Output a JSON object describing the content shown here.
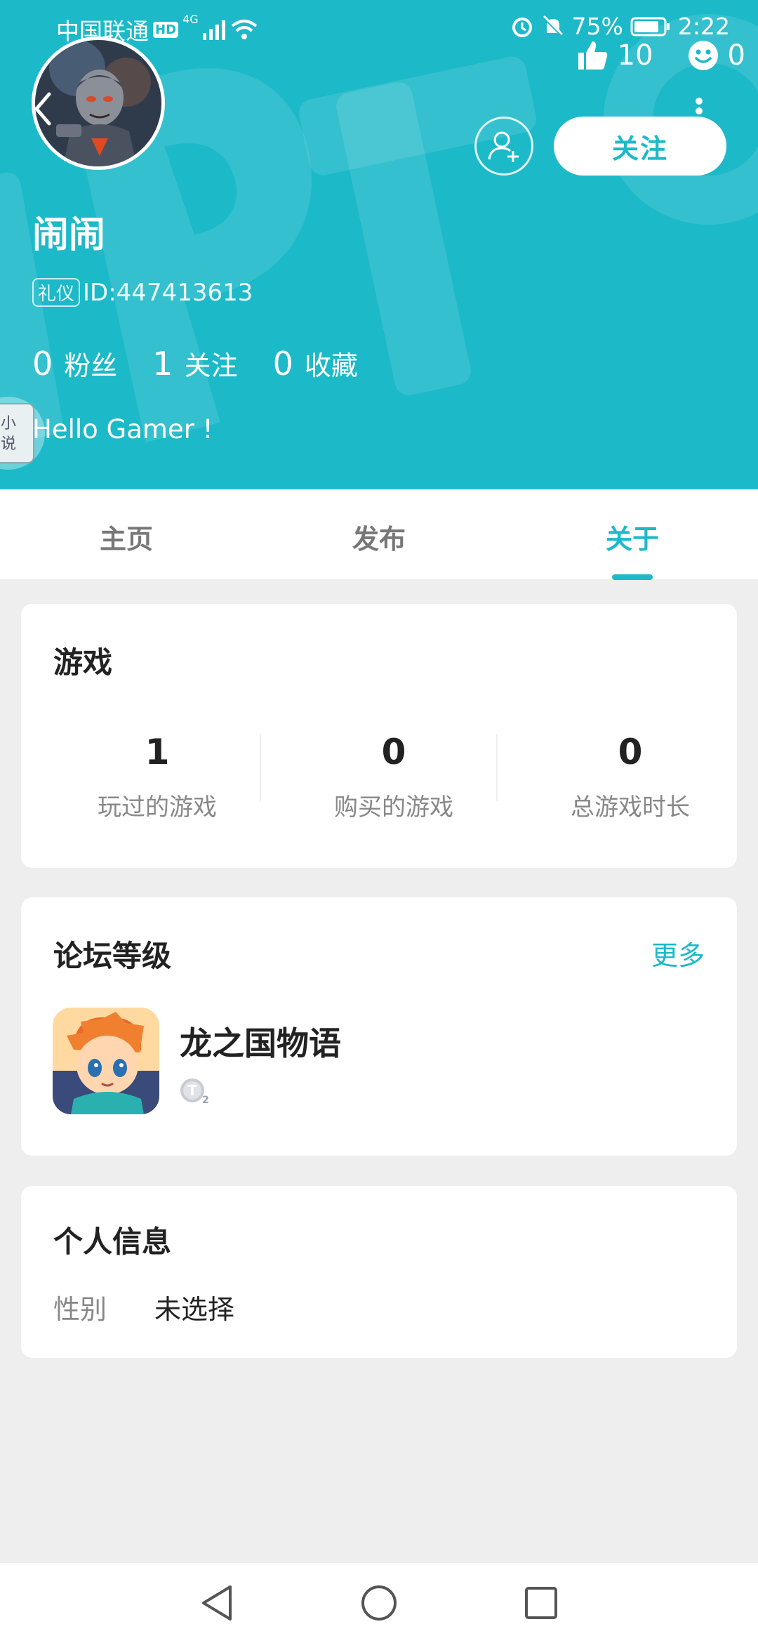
{
  "status_bar": {
    "carrier": "中国联通",
    "hd": "HD",
    "network": "4G",
    "battery": "75%",
    "time": "2:22"
  },
  "header_stats": {
    "likes": "10",
    "emoji_count": "0"
  },
  "profile": {
    "name": "闹闹",
    "rank_tag": "礼仪",
    "id_text": "ID:447413613",
    "fans_count": "0",
    "fans_label": "粉丝",
    "following_count": "1",
    "following_label": "关注",
    "favorites_count": "0",
    "favorites_label": "收藏",
    "bio": "Hello Gamer !",
    "follow_button": "关注"
  },
  "novel_float": {
    "line1": "小",
    "line2": "说"
  },
  "tabs": [
    {
      "label": "主页"
    },
    {
      "label": "发布"
    },
    {
      "label": "关于",
      "active": true
    }
  ],
  "games_card": {
    "title": "游戏",
    "stats": [
      {
        "value": "1",
        "label": "玩过的游戏"
      },
      {
        "value": "0",
        "label": "购买的游戏"
      },
      {
        "value": "0",
        "label": "总游戏时长"
      }
    ]
  },
  "forum_card": {
    "title": "论坛等级",
    "more": "更多",
    "game_name": "龙之国物语",
    "level_letter": "T",
    "level_num": "2"
  },
  "info_card": {
    "title": "个人信息",
    "gender_key": "性别",
    "gender_value": "未选择"
  },
  "colors": {
    "accent": "#1cb9c8",
    "background": "#eeeeee"
  }
}
